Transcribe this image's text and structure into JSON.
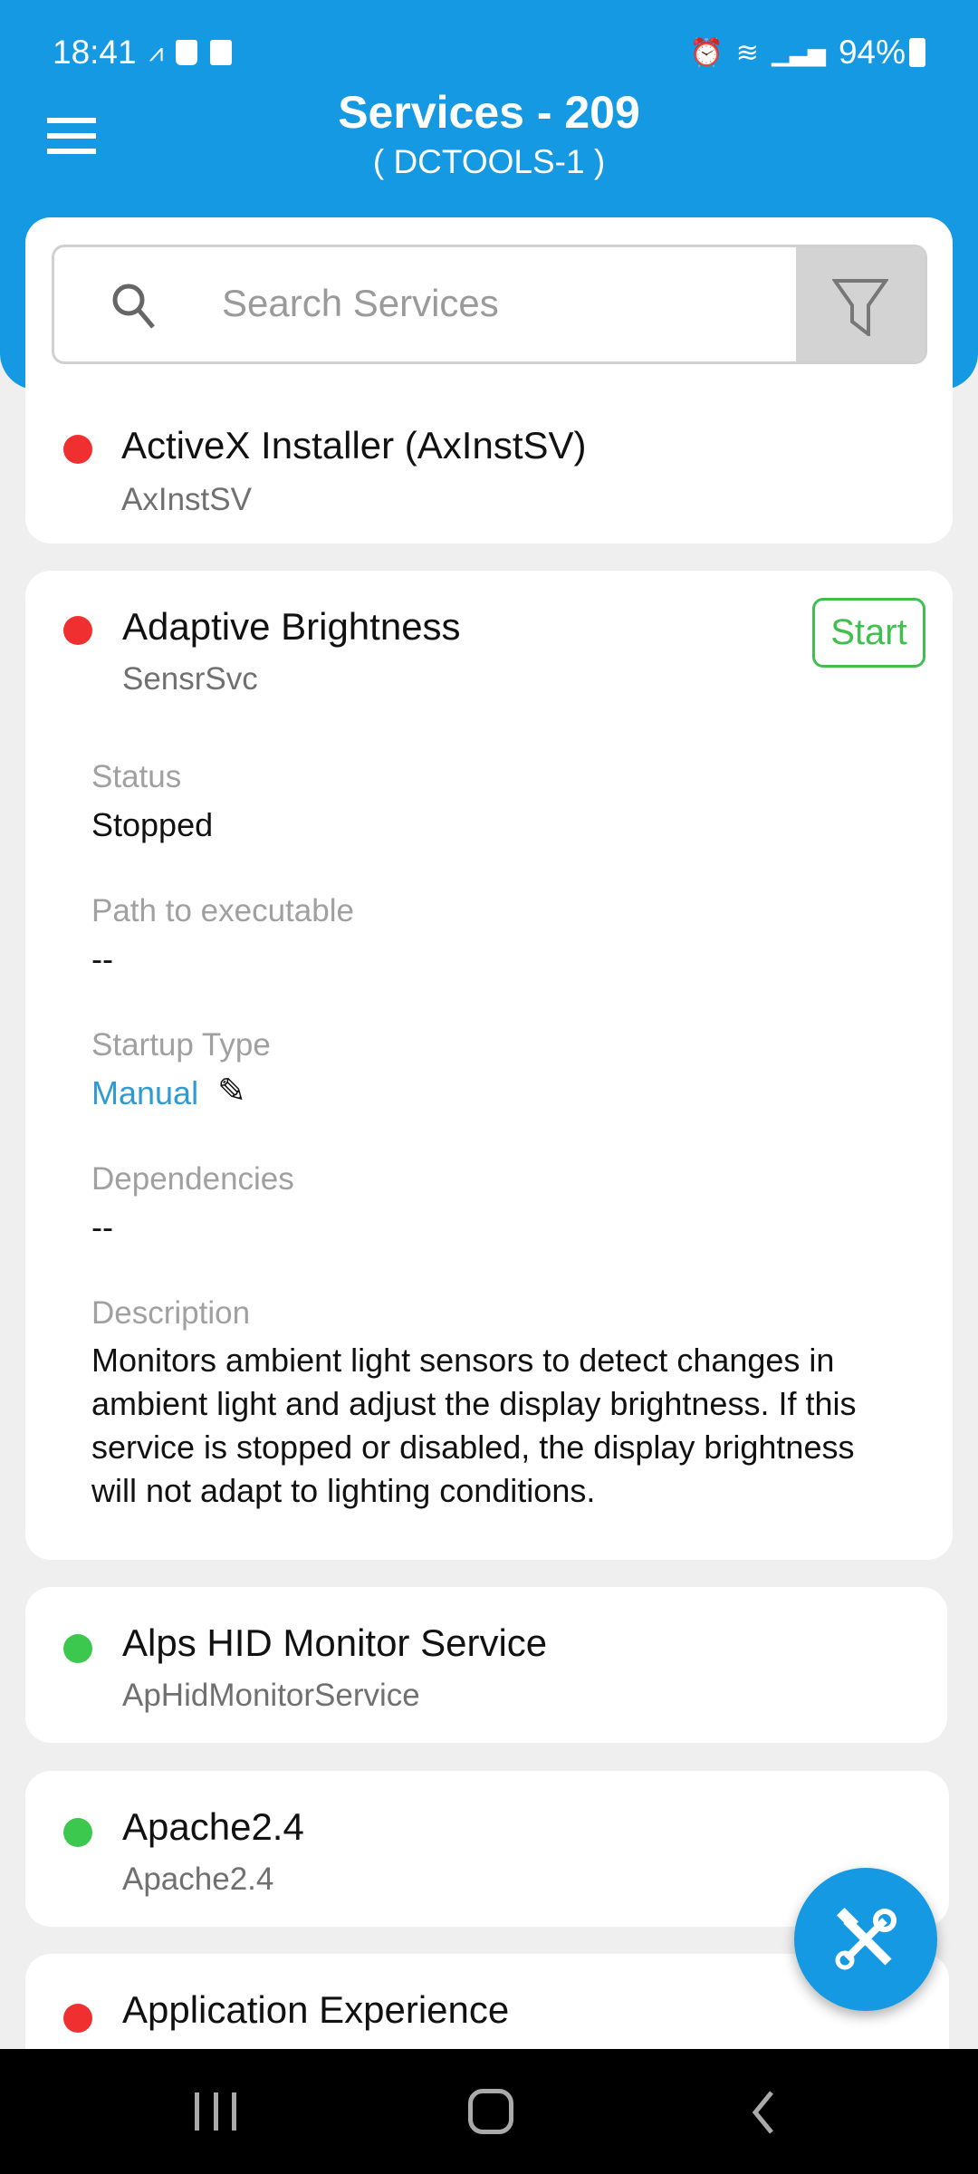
{
  "status_bar": {
    "time": "18:41",
    "battery": "94%"
  },
  "header": {
    "title": "Services - 209",
    "subtitle": "( DCTOOLS-1 )"
  },
  "search": {
    "placeholder": "Search Services"
  },
  "colors": {
    "accent": "#1499e2",
    "stopped": "#f03030",
    "running": "#3cc84e",
    "link": "#2f9bd6"
  },
  "services": [
    {
      "name": "ActiveX Installer (AxInstSV)",
      "id": "AxInstSV",
      "state": "stopped"
    },
    {
      "name": "Adaptive Brightness",
      "id": "SensrSvc",
      "state": "stopped",
      "action": "Start",
      "details": {
        "status_label": "Status",
        "status": "Stopped",
        "path_label": "Path to executable",
        "path": "--",
        "startup_label": "Startup Type",
        "startup": "Manual",
        "deps_label": "Dependencies",
        "deps": "--",
        "desc_label": "Description",
        "desc": "Monitors ambient light sensors to detect changes in ambient light and adjust the display brightness. If this service is stopped or disabled, the display brightness will not adapt to lighting conditions."
      }
    },
    {
      "name": "Alps HID Monitor Service",
      "id": "ApHidMonitorService",
      "state": "running"
    },
    {
      "name": "Apache2.4",
      "id": "Apache2.4",
      "state": "running"
    },
    {
      "name": "Application Experience",
      "state": "stopped"
    }
  ]
}
